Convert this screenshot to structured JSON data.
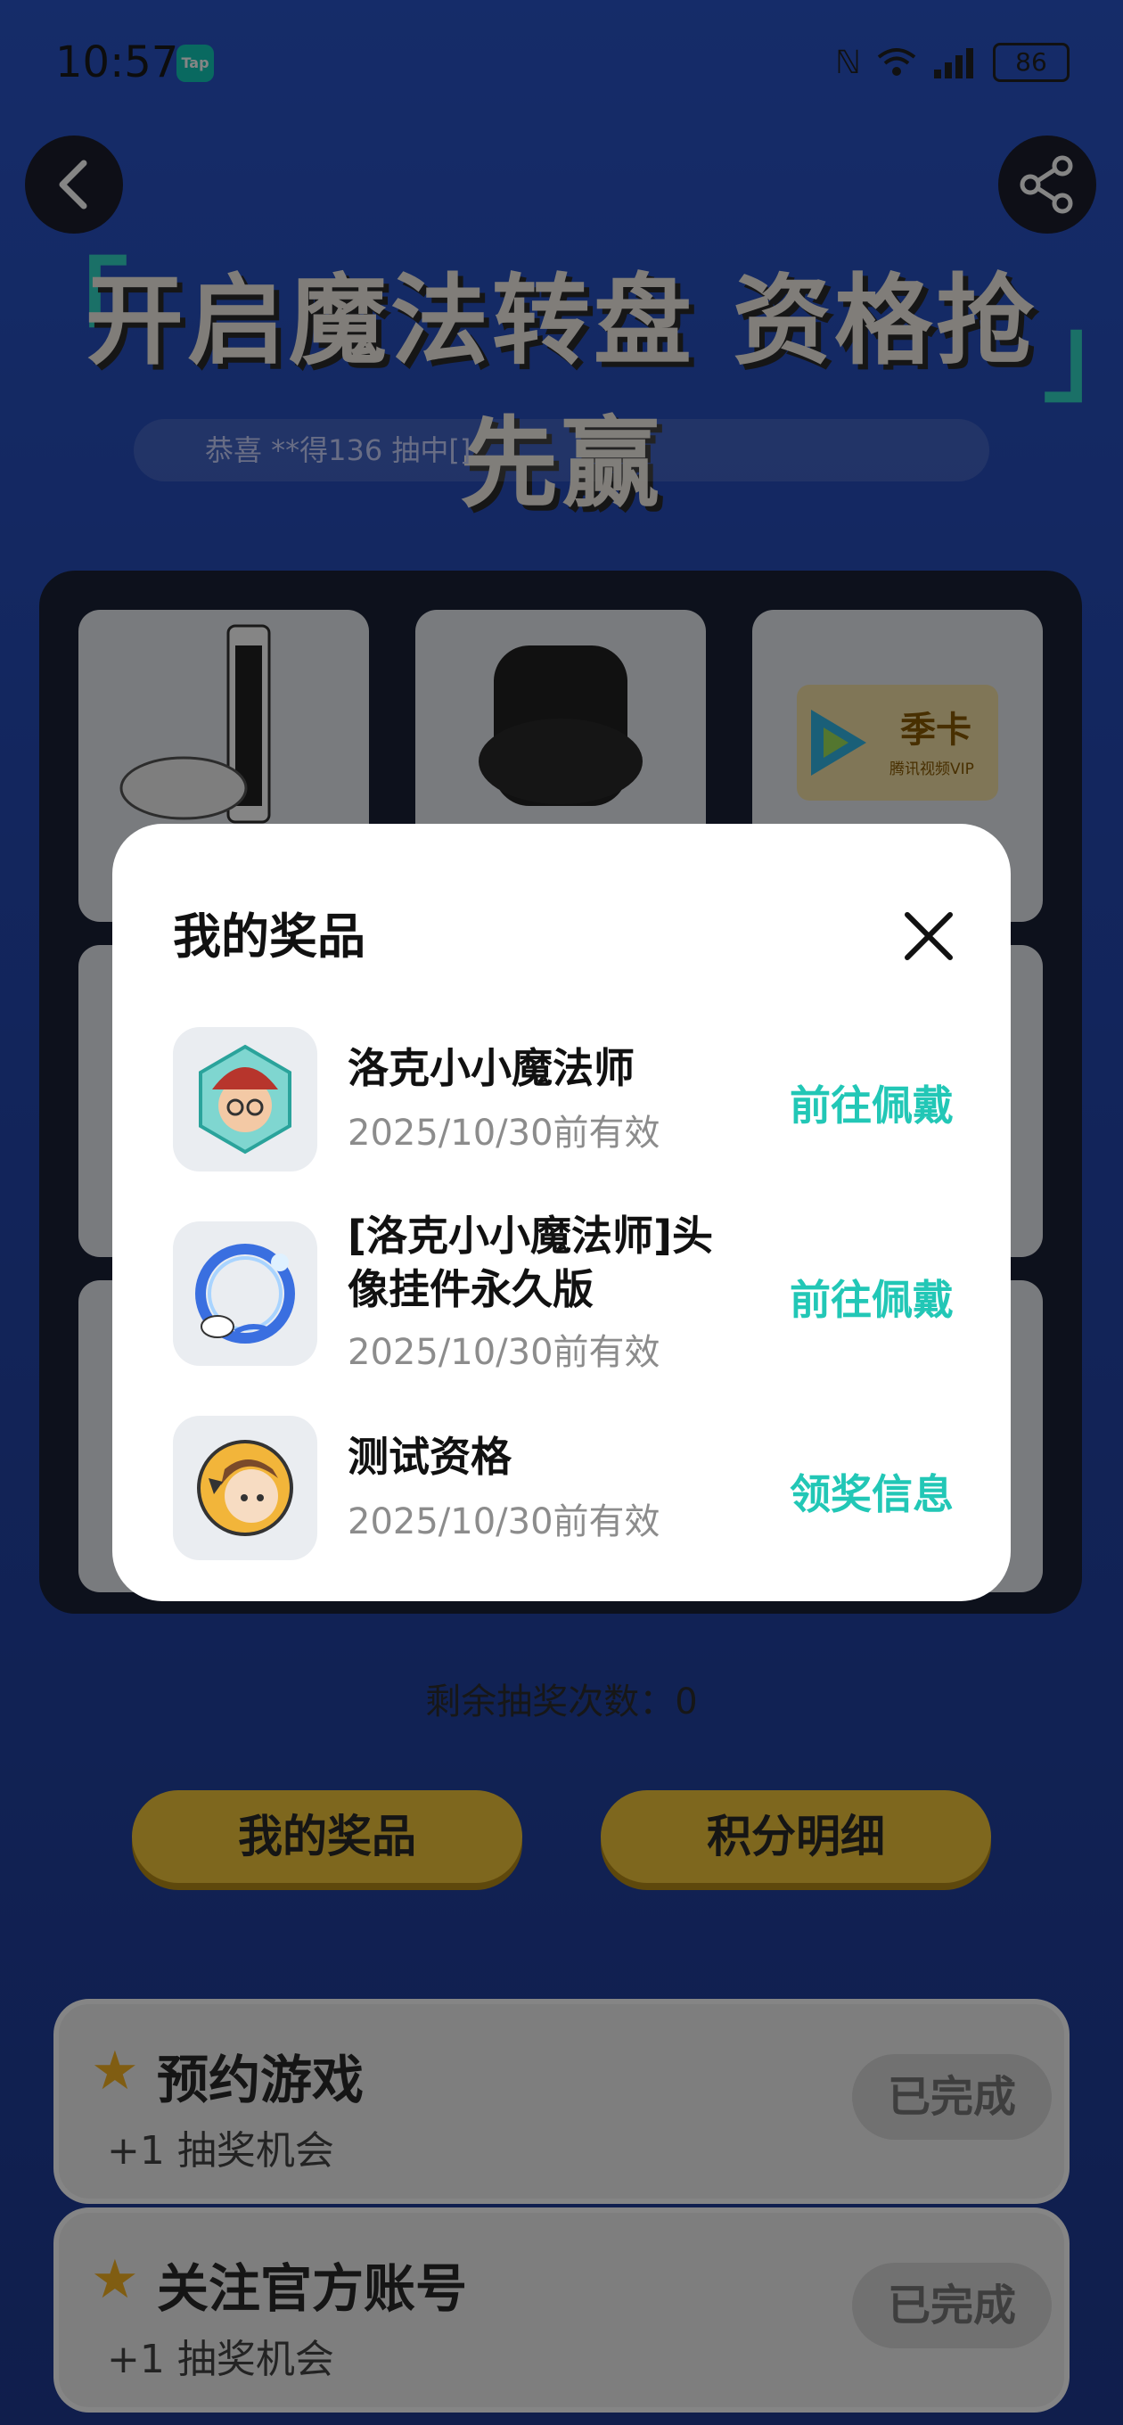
{
  "status_bar": {
    "time": "10:57",
    "app_badge": "Tap",
    "battery": "86"
  },
  "page": {
    "title": "开启魔法转盘 资格抢先赢",
    "marquee": {
      "prefix": "恭喜 **得136 抽中[",
      "highlight": "",
      "suffix": "]"
    },
    "grid_labels": {
      "card_label": "季卡",
      "card_sub": "腾讯视频VIP"
    },
    "remaining_label": "剩余抽奖次数：",
    "remaining_count": "0",
    "buttons": {
      "my_prizes": "我的奖品",
      "points_detail": "积分明细"
    },
    "tasks": [
      {
        "title": "预约游戏",
        "reward": "+1 抽奖机会",
        "status": "已完成"
      },
      {
        "title": "关注官方账号",
        "reward": "+1 抽奖机会",
        "status": "已完成"
      }
    ]
  },
  "modal": {
    "title": "我的奖品",
    "items": [
      {
        "name": "洛克小小魔法师",
        "valid": "2025/10/30前有效",
        "action": "前往佩戴",
        "icon": "wizard-avatar-icon"
      },
      {
        "name_line1": "[洛克小小魔法师]头",
        "name_line2": "像挂件永久版",
        "valid": "2025/10/30前有效",
        "action": "前往佩戴",
        "icon": "avatar-frame-icon"
      },
      {
        "name": "测试资格",
        "valid": "2025/10/30前有效",
        "action": "领奖信息",
        "icon": "boy-avatar-icon"
      }
    ]
  },
  "colors": {
    "accent": "#22c7b6",
    "button_yellow": "#f2c53a",
    "bg_blue": "#2549b3"
  }
}
